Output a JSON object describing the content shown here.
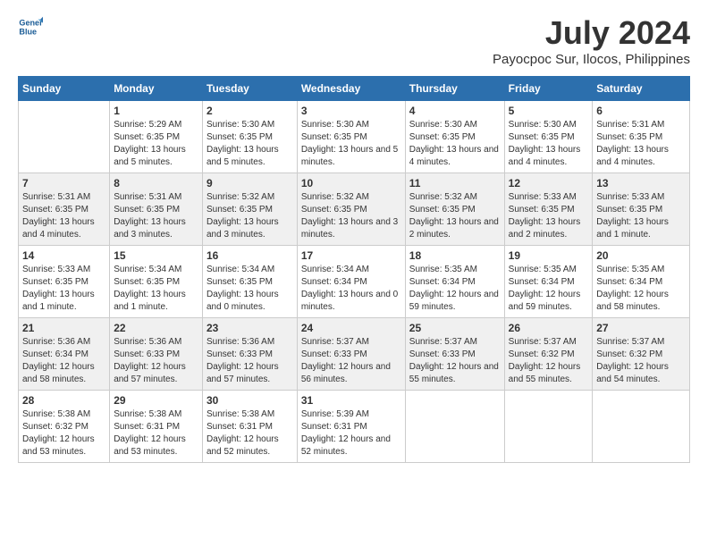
{
  "header": {
    "logo_line1": "General",
    "logo_line2": "Blue",
    "title": "July 2024",
    "subtitle": "Payocpoc Sur, Ilocos, Philippines"
  },
  "calendar": {
    "days_of_week": [
      "Sunday",
      "Monday",
      "Tuesday",
      "Wednesday",
      "Thursday",
      "Friday",
      "Saturday"
    ],
    "weeks": [
      [
        {
          "day": "",
          "info": ""
        },
        {
          "day": "1",
          "info": "Sunrise: 5:29 AM\nSunset: 6:35 PM\nDaylight: 13 hours\nand 5 minutes."
        },
        {
          "day": "2",
          "info": "Sunrise: 5:30 AM\nSunset: 6:35 PM\nDaylight: 13 hours\nand 5 minutes."
        },
        {
          "day": "3",
          "info": "Sunrise: 5:30 AM\nSunset: 6:35 PM\nDaylight: 13 hours\nand 5 minutes."
        },
        {
          "day": "4",
          "info": "Sunrise: 5:30 AM\nSunset: 6:35 PM\nDaylight: 13 hours\nand 4 minutes."
        },
        {
          "day": "5",
          "info": "Sunrise: 5:30 AM\nSunset: 6:35 PM\nDaylight: 13 hours\nand 4 minutes."
        },
        {
          "day": "6",
          "info": "Sunrise: 5:31 AM\nSunset: 6:35 PM\nDaylight: 13 hours\nand 4 minutes."
        }
      ],
      [
        {
          "day": "7",
          "info": "Sunrise: 5:31 AM\nSunset: 6:35 PM\nDaylight: 13 hours\nand 4 minutes."
        },
        {
          "day": "8",
          "info": "Sunrise: 5:31 AM\nSunset: 6:35 PM\nDaylight: 13 hours\nand 3 minutes."
        },
        {
          "day": "9",
          "info": "Sunrise: 5:32 AM\nSunset: 6:35 PM\nDaylight: 13 hours\nand 3 minutes."
        },
        {
          "day": "10",
          "info": "Sunrise: 5:32 AM\nSunset: 6:35 PM\nDaylight: 13 hours\nand 3 minutes."
        },
        {
          "day": "11",
          "info": "Sunrise: 5:32 AM\nSunset: 6:35 PM\nDaylight: 13 hours\nand 2 minutes."
        },
        {
          "day": "12",
          "info": "Sunrise: 5:33 AM\nSunset: 6:35 PM\nDaylight: 13 hours\nand 2 minutes."
        },
        {
          "day": "13",
          "info": "Sunrise: 5:33 AM\nSunset: 6:35 PM\nDaylight: 13 hours\nand 1 minute."
        }
      ],
      [
        {
          "day": "14",
          "info": "Sunrise: 5:33 AM\nSunset: 6:35 PM\nDaylight: 13 hours\nand 1 minute."
        },
        {
          "day": "15",
          "info": "Sunrise: 5:34 AM\nSunset: 6:35 PM\nDaylight: 13 hours\nand 1 minute."
        },
        {
          "day": "16",
          "info": "Sunrise: 5:34 AM\nSunset: 6:35 PM\nDaylight: 13 hours\nand 0 minutes."
        },
        {
          "day": "17",
          "info": "Sunrise: 5:34 AM\nSunset: 6:34 PM\nDaylight: 13 hours\nand 0 minutes."
        },
        {
          "day": "18",
          "info": "Sunrise: 5:35 AM\nSunset: 6:34 PM\nDaylight: 12 hours\nand 59 minutes."
        },
        {
          "day": "19",
          "info": "Sunrise: 5:35 AM\nSunset: 6:34 PM\nDaylight: 12 hours\nand 59 minutes."
        },
        {
          "day": "20",
          "info": "Sunrise: 5:35 AM\nSunset: 6:34 PM\nDaylight: 12 hours\nand 58 minutes."
        }
      ],
      [
        {
          "day": "21",
          "info": "Sunrise: 5:36 AM\nSunset: 6:34 PM\nDaylight: 12 hours\nand 58 minutes."
        },
        {
          "day": "22",
          "info": "Sunrise: 5:36 AM\nSunset: 6:33 PM\nDaylight: 12 hours\nand 57 minutes."
        },
        {
          "day": "23",
          "info": "Sunrise: 5:36 AM\nSunset: 6:33 PM\nDaylight: 12 hours\nand 57 minutes."
        },
        {
          "day": "24",
          "info": "Sunrise: 5:37 AM\nSunset: 6:33 PM\nDaylight: 12 hours\nand 56 minutes."
        },
        {
          "day": "25",
          "info": "Sunrise: 5:37 AM\nSunset: 6:33 PM\nDaylight: 12 hours\nand 55 minutes."
        },
        {
          "day": "26",
          "info": "Sunrise: 5:37 AM\nSunset: 6:32 PM\nDaylight: 12 hours\nand 55 minutes."
        },
        {
          "day": "27",
          "info": "Sunrise: 5:37 AM\nSunset: 6:32 PM\nDaylight: 12 hours\nand 54 minutes."
        }
      ],
      [
        {
          "day": "28",
          "info": "Sunrise: 5:38 AM\nSunset: 6:32 PM\nDaylight: 12 hours\nand 53 minutes."
        },
        {
          "day": "29",
          "info": "Sunrise: 5:38 AM\nSunset: 6:31 PM\nDaylight: 12 hours\nand 53 minutes."
        },
        {
          "day": "30",
          "info": "Sunrise: 5:38 AM\nSunset: 6:31 PM\nDaylight: 12 hours\nand 52 minutes."
        },
        {
          "day": "31",
          "info": "Sunrise: 5:39 AM\nSunset: 6:31 PM\nDaylight: 12 hours\nand 52 minutes."
        },
        {
          "day": "",
          "info": ""
        },
        {
          "day": "",
          "info": ""
        },
        {
          "day": "",
          "info": ""
        }
      ]
    ]
  }
}
